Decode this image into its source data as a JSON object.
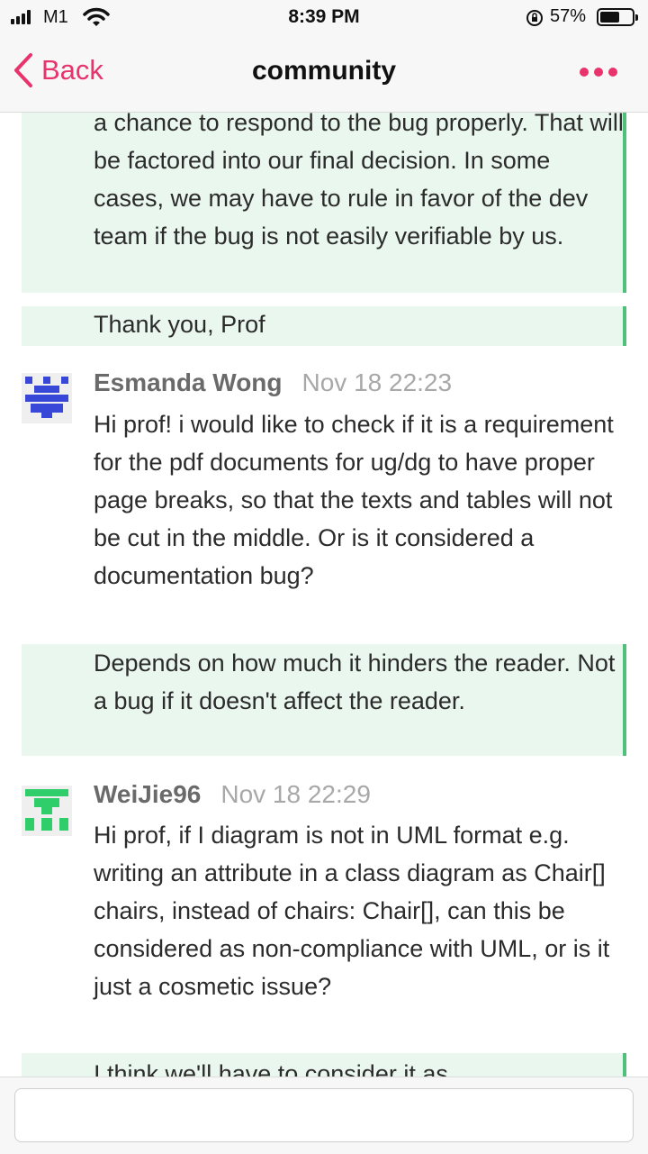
{
  "status_bar": {
    "carrier": "M1",
    "time": "8:39 PM",
    "battery_percent": "57%",
    "battery_level": 0.57
  },
  "nav": {
    "back_label": "Back",
    "title": "community"
  },
  "colors": {
    "accent": "#e8336d",
    "quote_bg": "#eaf7ef",
    "quote_border": "#4fc07a",
    "avatar_blue": "#3747d8",
    "avatar_green": "#2fce6a"
  },
  "messages": {
    "m0_reply_text": "a chance to respond to the bug properly. That will be factored into our final decision. In some cases, we may have to rule in favor of the dev team if the bug is not easily verifiable by us.",
    "m0_sign": "Thank you, Prof",
    "m1_author": "Esmanda Wong",
    "m1_time": "Nov 18 22:23",
    "m1_text": "Hi prof! i would like to check if it is a requirement for the pdf documents for ug/dg to have proper page breaks, so that the texts and tables will not be cut in the middle. Or is it considered a documentation bug?",
    "m1_reply": "Depends on how much it hinders the reader. Not a bug if it doesn't affect the reader.",
    "m2_author": "WeiJie96",
    "m2_time": "Nov 18 22:29",
    "m2_text": "Hi prof, if I diagram is not in UML format e.g. writing an attribute in a class diagram as Chair[] chairs, instead of chairs: Chair[], can this be considered as non-compliance with UML, or is it just a cosmetic issue?",
    "m2_reply_partial": "I think we'll have to consider it as"
  },
  "composer": {
    "placeholder": ""
  }
}
